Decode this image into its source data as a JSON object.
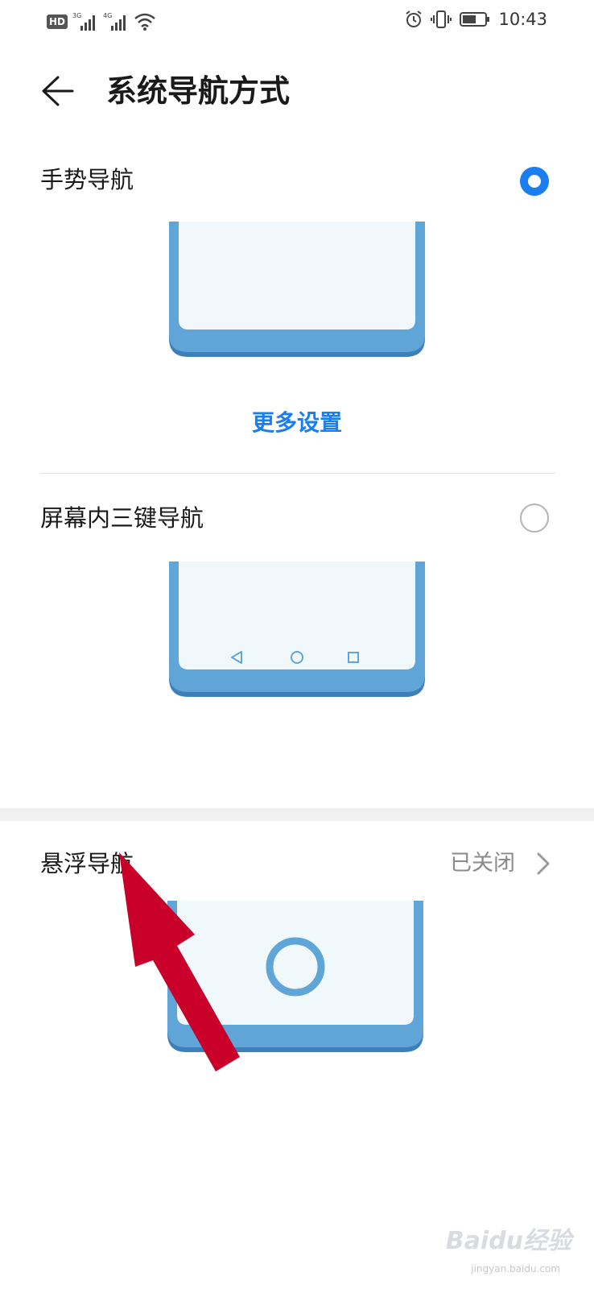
{
  "status_bar": {
    "hd_label": "HD",
    "sig1_label": "3G",
    "sig2_label": "4G",
    "time": "10:43"
  },
  "header": {
    "title": "系统导航方式"
  },
  "options": [
    {
      "label": "手势导航",
      "selected": true,
      "action": "更多设置"
    },
    {
      "label": "屏幕内三键导航",
      "selected": false
    },
    {
      "label": "悬浮导航",
      "status": "已关闭"
    }
  ],
  "colors": {
    "accent": "#1a7ef0",
    "phone_body": "#5fa5d8",
    "phone_screen": "#f1f8fc",
    "arrow": "#c8002a"
  },
  "watermark": {
    "brand": "Baidu经验",
    "url": "jingyan.baidu.com"
  }
}
